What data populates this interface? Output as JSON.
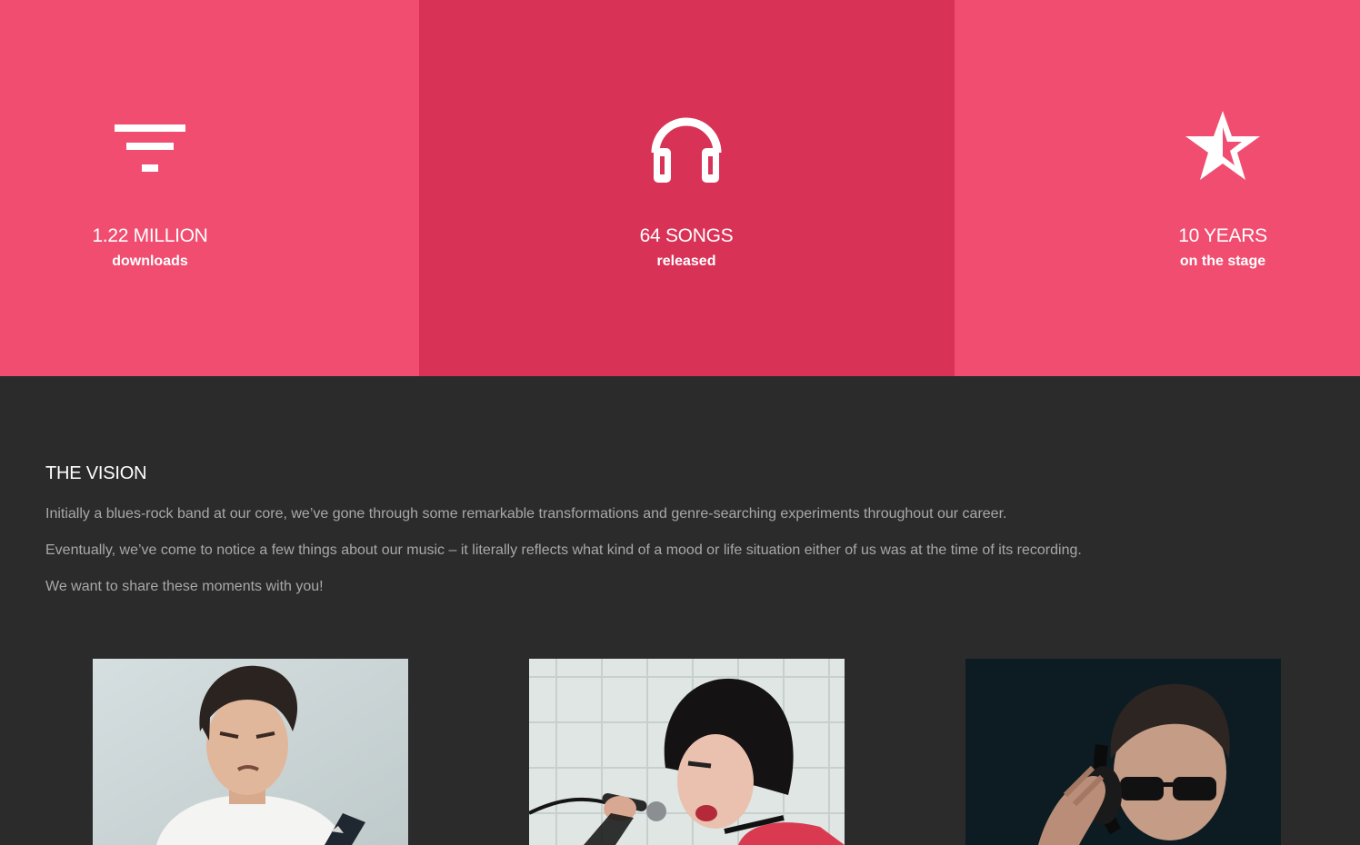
{
  "colors": {
    "stat_panel_light": "#f04d70",
    "stat_panel_dark": "#d93257",
    "background": "#2b2b2b",
    "heading": "#ffffff",
    "body_text": "#a8a8a8"
  },
  "stats": [
    {
      "icon": "filter-icon",
      "value": "1.22 MILLION",
      "caption": "downloads"
    },
    {
      "icon": "headphones-icon",
      "value": "64 SONGS",
      "caption": "released"
    },
    {
      "icon": "half-star-icon",
      "value": "10 YEARS",
      "caption": "on the stage"
    }
  ],
  "vision": {
    "title": "THE VISION",
    "paragraphs": [
      "Initially a blues-rock band at our core, we’ve gone through some remarkable transformations and genre-searching experiments throughout our career.",
      "Eventually, we’ve come to notice a few things about our music – it literally reflects what kind of a mood or life situation either of us was at the time of its recording.",
      "We want to share these moments with you!"
    ]
  },
  "members": [
    {
      "photo": "guitarist-photo"
    },
    {
      "photo": "singer-photo"
    },
    {
      "photo": "dj-photo"
    }
  ]
}
